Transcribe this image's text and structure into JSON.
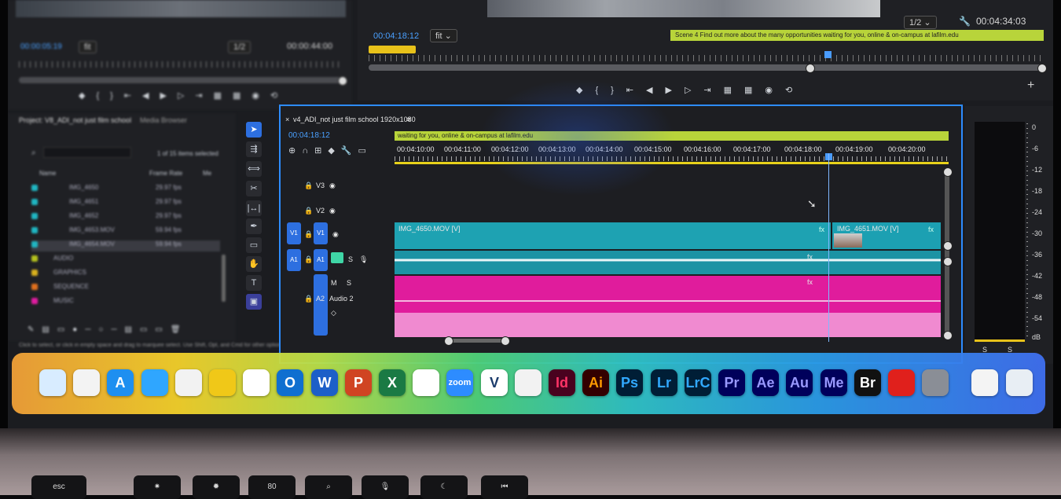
{
  "source_monitor": {
    "timecode": "00:00:05:19",
    "zoom": "fit",
    "resolution": "1/2",
    "duration": "00:00:44:00"
  },
  "program_monitor": {
    "timecode": "00:04:18:12",
    "zoom": "fit",
    "resolution": "1/2",
    "duration": "00:04:34:03",
    "caption": "Scene 4 Find out more about the many opportunities waiting for you, online & on-campus at lafilm.edu"
  },
  "project": {
    "tabs": [
      "Project: V8_ADI_not just film school",
      "Media Browser"
    ],
    "filter_status": "1 of 15 items selected",
    "columns": [
      "Name",
      "Frame Rate",
      "Me"
    ],
    "items": [
      {
        "color": "#1fb6c2",
        "name": "IMG_4650",
        "rate": "29.97 fps"
      },
      {
        "color": "#1fb6c2",
        "name": "IMG_4651",
        "rate": "29.97 fps"
      },
      {
        "color": "#1fb6c2",
        "name": "IMG_4652",
        "rate": "29.97 fps"
      },
      {
        "color": "#1fb6c2",
        "name": "IMG_4653.MOV",
        "rate": "59.94 fps"
      },
      {
        "color": "#1fb6c2",
        "name": "IMG_4654.MOV",
        "rate": "59.94 fps"
      },
      {
        "color": "#b5c21e",
        "name": "AUDIO",
        "rate": ""
      },
      {
        "color": "#d9b11e",
        "name": "GRAPHICS",
        "rate": ""
      },
      {
        "color": "#e0701e",
        "name": "SEQUENCE",
        "rate": ""
      },
      {
        "color": "#e01ca0",
        "name": "MUSIC",
        "rate": ""
      }
    ],
    "status": "Click to select, or click in empty space and drag to marquee select. Use Shift, Opt, and Cmd for other options."
  },
  "timeline": {
    "tab": "v4_ADI_not just film school 1920x1080",
    "timecode": "00:04:18:12",
    "caption_bar": "waiting for you, online & on-campus at lafilm.edu",
    "ruler": [
      "00:04:10:00",
      "00:04:11:00",
      "00:04:12:00",
      "00:04:13:00",
      "00:04:14:00",
      "00:04:15:00",
      "00:04:16:00",
      "00:04:17:00",
      "00:04:18:00",
      "00:04:19:00",
      "00:04:20:00"
    ],
    "tracks": {
      "v3": "V3",
      "v2": "V2",
      "v1": "V1",
      "a1": "A1",
      "a2": "A2",
      "audio2": "Audio 2"
    },
    "clip1": "IMG_4650.MOV [V]",
    "clip2": "IMG_4651.MOV [V]",
    "fx": "fx"
  },
  "meters": {
    "scale": [
      "0",
      "-6",
      "-12",
      "-18",
      "-24",
      "-30",
      "-36",
      "-42",
      "-48",
      "-54",
      "dB"
    ],
    "solo": "S"
  },
  "dock": {
    "apps": [
      {
        "name": "finder-icon",
        "label": "",
        "bg": "#d8ecff",
        "fg": "#2a78d8"
      },
      {
        "name": "launchpad-icon",
        "label": "",
        "bg": "#f3f3f3",
        "fg": "#999"
      },
      {
        "name": "app-store-icon",
        "label": "A",
        "bg": "#1e8ff0",
        "fg": "#fff"
      },
      {
        "name": "safari-icon",
        "label": "",
        "bg": "#2fa6ff",
        "fg": "#fff"
      },
      {
        "name": "chrome-icon",
        "label": "",
        "bg": "#f2f2f2",
        "fg": "#e04030"
      },
      {
        "name": "smile-icon",
        "label": "",
        "bg": "#f0c818",
        "fg": "#333"
      },
      {
        "name": "slack-icon",
        "label": "",
        "bg": "#ffffff",
        "fg": "#e01e5a"
      },
      {
        "name": "outlook-icon",
        "label": "O",
        "bg": "#0f6fd0",
        "fg": "#fff"
      },
      {
        "name": "word-icon",
        "label": "W",
        "bg": "#1d5fc8",
        "fg": "#fff"
      },
      {
        "name": "powerpoint-icon",
        "label": "P",
        "bg": "#d04422",
        "fg": "#fff"
      },
      {
        "name": "excel-icon",
        "label": "X",
        "bg": "#1a7a44",
        "fg": "#fff"
      },
      {
        "name": "vpn-icon",
        "label": "",
        "bg": "#ffffff",
        "fg": "#e07020"
      },
      {
        "name": "zoom-icon",
        "label": "zoom",
        "bg": "#2d8cff",
        "fg": "#fff"
      },
      {
        "name": "vectorworks-icon",
        "label": "V",
        "bg": "#ffffff",
        "fg": "#1b3b6b"
      },
      {
        "name": "creative-cloud-icon",
        "label": "",
        "bg": "#f2f2f2",
        "fg": "#5ab82a"
      },
      {
        "name": "indesign-icon",
        "label": "Id",
        "bg": "#49021f",
        "fg": "#ff3366"
      },
      {
        "name": "illustrator-icon",
        "label": "Ai",
        "bg": "#330000",
        "fg": "#ff9a00"
      },
      {
        "name": "photoshop-icon",
        "label": "Ps",
        "bg": "#001e36",
        "fg": "#31a8ff"
      },
      {
        "name": "lightroom-icon",
        "label": "Lr",
        "bg": "#001e36",
        "fg": "#31a8ff"
      },
      {
        "name": "lightroom-classic-icon",
        "label": "LrC",
        "bg": "#001e36",
        "fg": "#31a8ff"
      },
      {
        "name": "premiere-icon",
        "label": "Pr",
        "bg": "#00005b",
        "fg": "#9999ff"
      },
      {
        "name": "after-effects-icon",
        "label": "Ae",
        "bg": "#00005b",
        "fg": "#9999ff"
      },
      {
        "name": "audition-icon",
        "label": "Au",
        "bg": "#00005b",
        "fg": "#9999ff"
      },
      {
        "name": "media-encoder-icon",
        "label": "Me",
        "bg": "#00005b",
        "fg": "#9999ff"
      },
      {
        "name": "bridge-icon",
        "label": "Br",
        "bg": "#111111",
        "fg": "#ffffff"
      },
      {
        "name": "acrobat-icon",
        "label": "",
        "bg": "#e0201c",
        "fg": "#fff"
      },
      {
        "name": "system-settings-icon",
        "label": "",
        "bg": "#8a8e96",
        "fg": "#333"
      },
      {
        "name": "qr-document-icon",
        "label": "",
        "bg": "#f4f4f4",
        "fg": "#333"
      },
      {
        "name": "trash-icon",
        "label": "",
        "bg": "#e8eef4",
        "fg": "#bbb"
      }
    ]
  },
  "keyboard": {
    "keys": [
      "esc",
      "",
      "",
      "80",
      "",
      "",
      "",
      "",
      "",
      ""
    ]
  }
}
